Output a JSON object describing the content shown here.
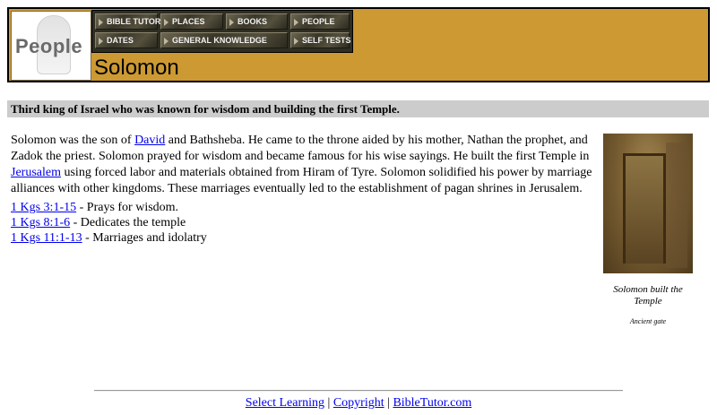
{
  "header": {
    "logo_text": "People",
    "nav": [
      {
        "label": "Bible Tutor"
      },
      {
        "label": "Places"
      },
      {
        "label": "Books"
      },
      {
        "label": "People"
      },
      {
        "label": "Dates"
      },
      {
        "label": "General Knowledge"
      },
      {
        "label": "Self Tests"
      }
    ],
    "page_title": "Solomon"
  },
  "summary": "Third king of Israel who was known for wisdom and building the first Temple.",
  "body": {
    "t1": "Solomon was the son of ",
    "link_david": "David",
    "t2": " and Bathsheba. He came to the throne aided by his mother, Nathan the prophet, and Zadok the priest. Solomon prayed for wisdom and became famous for his wise sayings. He built the first Temple in ",
    "link_jerusalem": "Jerusalem",
    "t3": " using forced labor and materials obtained from Hiram of Tyre. Solomon solidified his power by marriage alliances with other kingdoms. These marriages eventually led to the establishment of pagan shrines in Jerusalem."
  },
  "references": [
    {
      "link": "1 Kgs 3:1-15",
      "text": " - Prays for wisdom."
    },
    {
      "link": "1 Kgs 8:1-6",
      "text": " - Dedicates the temple"
    },
    {
      "link": "1 Kgs 11:1-13",
      "text": " - Marriages and idolatry"
    }
  ],
  "image": {
    "caption": "Solomon built the Temple",
    "credit": "Ancient gate"
  },
  "footer": {
    "links": [
      "Select Learning",
      "Copyright",
      "BibleTutor.com"
    ],
    "separator": " | "
  }
}
